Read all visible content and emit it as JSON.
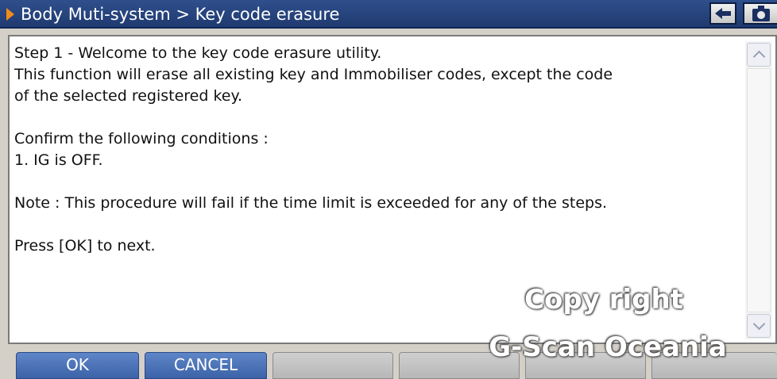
{
  "window": {
    "title": "Body Muti-system > Key code erasure",
    "back_icon": "back-arrow-icon",
    "capture_icon": "camera-icon",
    "accent_color": "#f08b1a",
    "titlebar_color": "#2f4f8c"
  },
  "message": {
    "text": "Step 1 - Welcome to the key code erasure utility.\nThis function will erase all existing key and Immobiliser codes, except the code\nof the selected registered key.\n\nConfirm the following conditions :\n1. IG is OFF.\n\nNote : This procedure will fail if the time limit is exceeded for any of the steps.\n\nPress [OK] to next."
  },
  "buttons": {
    "ok_label": "OK",
    "cancel_label": "CANCEL",
    "active_color": "#4a70b4"
  },
  "watermark": {
    "line1": "Copy right",
    "line2": "G-Scan Oceania"
  }
}
